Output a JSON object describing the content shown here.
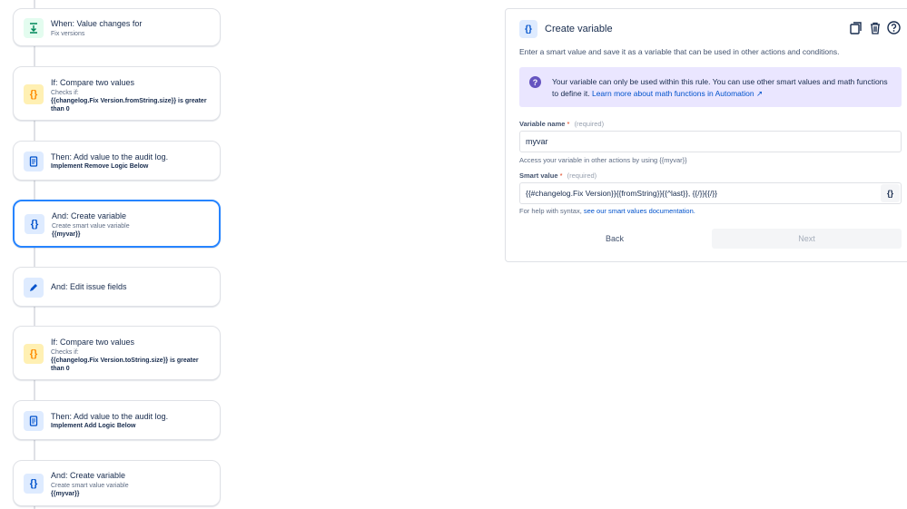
{
  "flow": {
    "cards": [
      {
        "title": "When: Value changes for",
        "sub": "Fix versions",
        "bold": "",
        "icon": "trigger-icon"
      },
      {
        "title": "If: Compare two values",
        "sub": "Checks if:",
        "bold": "{{changelog.Fix Version.fromString.size}} is greater than 0",
        "icon": "braces-icon"
      },
      {
        "title": "Then: Add value to the audit log.",
        "sub": "",
        "bold": "Implement Remove Logic Below",
        "icon": "audit-log-icon"
      },
      {
        "title": "And: Create variable",
        "sub": "Create smart value variable",
        "bold": "{{myvar}}",
        "icon": "braces-icon"
      },
      {
        "title": "And: Edit issue fields",
        "sub": "",
        "bold": "",
        "icon": "pencil-icon"
      },
      {
        "title": "If: Compare two values",
        "sub": "Checks if:",
        "bold": "{{changelog.Fix Version.toString.size}} is greater than 0",
        "icon": "braces-icon"
      },
      {
        "title": "Then: Add value to the audit log.",
        "sub": "",
        "bold": "Implement Add Logic Below",
        "icon": "audit-log-icon"
      },
      {
        "title": "And: Create variable",
        "sub": "Create smart value variable",
        "bold": "{{myvar}}",
        "icon": "braces-icon"
      }
    ]
  },
  "panel": {
    "icon_glyph": "{}",
    "title": "Create variable",
    "description": "Enter a smart value and save it as a variable that can be used in other actions and conditions.",
    "info_text": "Your variable can only be used within this rule. You can use other smart values and math functions to define it.",
    "info_link": "Learn more about math functions in Automation ↗",
    "variable_name_label": "Variable name",
    "required_mark": "*",
    "required_text": "(required)",
    "variable_name_value": "myvar",
    "variable_helper": "Access your variable in other actions by using {{myvar}}",
    "smart_value_label": "Smart value",
    "smart_value_value": "{{#changelog.Fix Version}}{{fromString}}{{^last}}, {{/}}{{/}}",
    "smart_value_button": "{}",
    "help_prefix": "For help with syntax,",
    "help_link": "see our smart values documentation.",
    "back_label": "Back",
    "next_label": "Next"
  },
  "colors": {
    "accent": "#0052cc",
    "selected_border": "#2684ff",
    "info_bg": "#eae6ff"
  }
}
